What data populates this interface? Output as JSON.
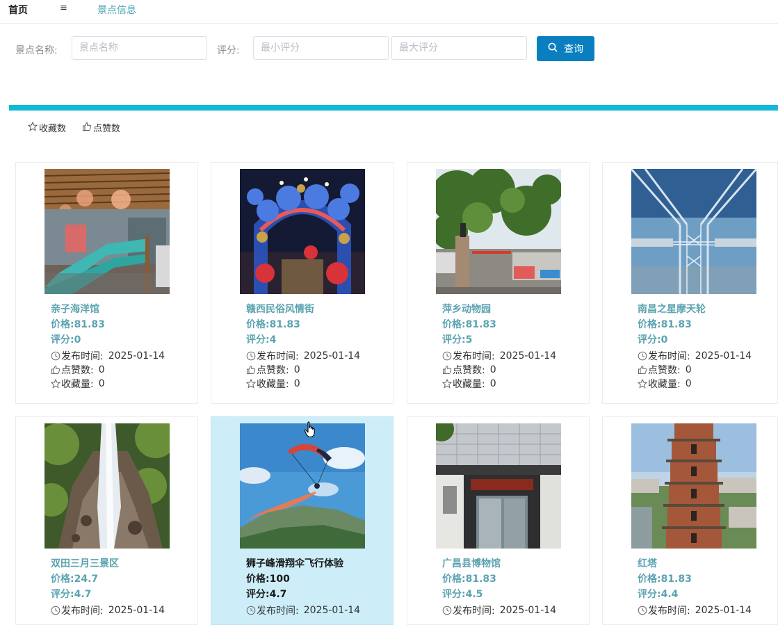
{
  "nav": {
    "home": "首页",
    "menu_icon": "≡",
    "title": "景点信息"
  },
  "search": {
    "name_label": "景点名称:",
    "name_placeholder": "景点名称",
    "score_label": "评分:",
    "min_placeholder": "最小评分",
    "max_placeholder": "最大评分",
    "button": "查询"
  },
  "sort": {
    "favorites": "收藏数",
    "likes": "点赞数"
  },
  "labels": {
    "published": "发布时间:",
    "likes": "点赞数:",
    "favorites": "收藏量:"
  },
  "cards": [
    {
      "name": "亲子海洋馆",
      "price": "价格:81.83",
      "score": "评分:0",
      "date": "2025-01-14",
      "likes": "0",
      "favorites": "0"
    },
    {
      "name": "赣西民俗风情街",
      "price": "价格:81.83",
      "score": "评分:4",
      "date": "2025-01-14",
      "likes": "0",
      "favorites": "0"
    },
    {
      "name": "萍乡动物园",
      "price": "价格:81.83",
      "score": "评分:5",
      "date": "2025-01-14",
      "likes": "0",
      "favorites": "0"
    },
    {
      "name": "南昌之星摩天轮",
      "price": "价格:81.83",
      "score": "评分:0",
      "date": "2025-01-14",
      "likes": "0",
      "favorites": "0"
    },
    {
      "name": "双田三月三景区",
      "price": "价格:24.7",
      "score": "评分:4.7",
      "date": "2025-01-14"
    },
    {
      "name": "狮子峰滑翔伞飞行体验",
      "price": "价格:100",
      "score": "评分:4.7",
      "date": "2025-01-14"
    },
    {
      "name": "广昌县博物馆",
      "price": "价格:81.83",
      "score": "评分:4.5",
      "date": "2025-01-14"
    },
    {
      "name": "红塔",
      "price": "价格:81.83",
      "score": "评分:4.4",
      "date": "2025-01-14"
    }
  ]
}
